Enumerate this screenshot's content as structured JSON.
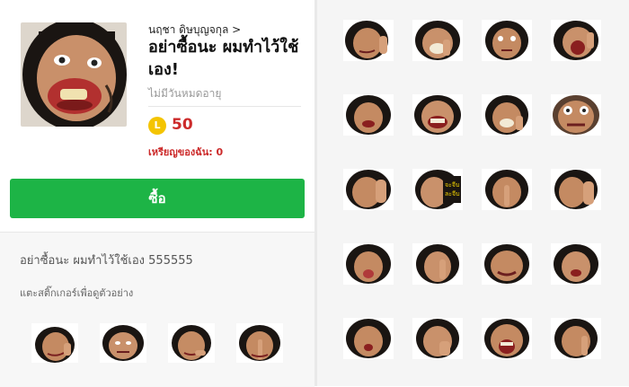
{
  "product": {
    "author": "นฤชา ดิษบุญจกุล >",
    "title": "อย่าซื้อนะ ผมทำไว้ใช้เอง!",
    "validity": "ไม่มีวันหมดอายุ",
    "coin_symbol": "L",
    "price": "50",
    "my_coins": "เหรียญของฉัน: 0"
  },
  "buy_button": {
    "label": "ซื้อ"
  },
  "description": "อย่าซื้อนะ ผมทำไว้ใช้เอง 555555",
  "hint": "แตะสติ๊กเกอร์เพื่อดูตัวอย่าง",
  "colors": {
    "buy_green": "#1db446",
    "price_red": "#cc2a2a",
    "coin_gold": "#f4c400"
  },
  "sticker_captions": [
    "จะจีบ",
    "ละจีบ"
  ]
}
